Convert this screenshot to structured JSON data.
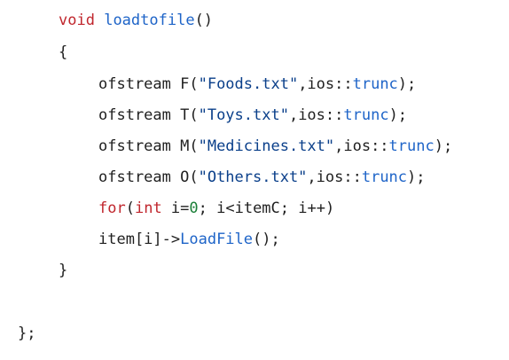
{
  "colors": {
    "default": "#1f1f1f",
    "keyword": "#c0262d",
    "function": "#1e64c8",
    "string": "#0a3f8a",
    "number": "#1a7f37"
  },
  "lines": [
    {
      "name": "function-signature",
      "indent": 1,
      "tokens": [
        {
          "t": "void",
          "k": "keyword"
        },
        {
          "t": " ",
          "k": "default"
        },
        {
          "t": "loadtofile",
          "k": "function"
        },
        {
          "t": "()",
          "k": "default"
        }
      ]
    },
    {
      "name": "open-brace",
      "indent": 1,
      "tokens": [
        {
          "t": "{",
          "k": "default"
        }
      ]
    },
    {
      "name": "ofstream-foods",
      "indent": 2,
      "tokens": [
        {
          "t": "ofstream F(",
          "k": "default"
        },
        {
          "t": "\"Foods.txt\"",
          "k": "string"
        },
        {
          "t": ",ios::",
          "k": "default"
        },
        {
          "t": "trunc",
          "k": "function"
        },
        {
          "t": ");",
          "k": "default"
        }
      ]
    },
    {
      "name": "ofstream-toys",
      "indent": 2,
      "tokens": [
        {
          "t": "ofstream T(",
          "k": "default"
        },
        {
          "t": "\"Toys.txt\"",
          "k": "string"
        },
        {
          "t": ",ios::",
          "k": "default"
        },
        {
          "t": "trunc",
          "k": "function"
        },
        {
          "t": ");",
          "k": "default"
        }
      ]
    },
    {
      "name": "ofstream-medicines",
      "indent": 2,
      "tokens": [
        {
          "t": "ofstream M(",
          "k": "default"
        },
        {
          "t": "\"Medicines.txt\"",
          "k": "string"
        },
        {
          "t": ",ios::",
          "k": "default"
        },
        {
          "t": "trunc",
          "k": "function"
        },
        {
          "t": ");",
          "k": "default"
        }
      ]
    },
    {
      "name": "ofstream-others",
      "indent": 2,
      "tokens": [
        {
          "t": "ofstream O(",
          "k": "default"
        },
        {
          "t": "\"Others.txt\"",
          "k": "string"
        },
        {
          "t": ",ios::",
          "k": "default"
        },
        {
          "t": "trunc",
          "k": "function"
        },
        {
          "t": ");",
          "k": "default"
        }
      ]
    },
    {
      "name": "for-loop",
      "indent": 2,
      "tokens": [
        {
          "t": "for",
          "k": "keyword"
        },
        {
          "t": "(",
          "k": "default"
        },
        {
          "t": "int",
          "k": "keyword"
        },
        {
          "t": " i=",
          "k": "default"
        },
        {
          "t": "0",
          "k": "number"
        },
        {
          "t": "; i<itemC; i++)",
          "k": "default"
        }
      ]
    },
    {
      "name": "loadfile-call",
      "indent": 2,
      "tokens": [
        {
          "t": "item[i]->",
          "k": "default"
        },
        {
          "t": "LoadFile",
          "k": "function"
        },
        {
          "t": "();",
          "k": "default"
        }
      ]
    },
    {
      "name": "close-brace",
      "indent": 1,
      "tokens": [
        {
          "t": "}",
          "k": "default"
        }
      ]
    },
    {
      "name": "class-end",
      "indent": 0,
      "tokens": [
        {
          "t": "};",
          "k": "default"
        }
      ]
    }
  ]
}
